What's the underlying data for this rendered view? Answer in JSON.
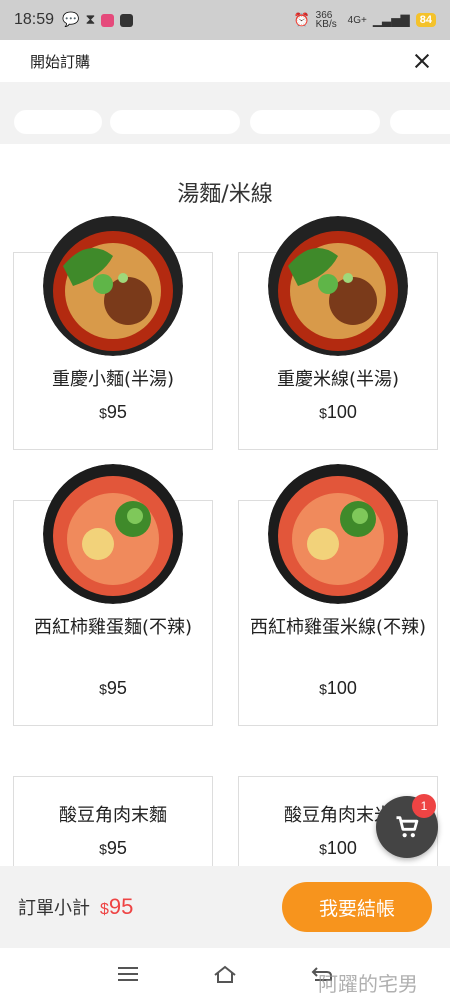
{
  "status_bar": {
    "time": "18:59",
    "battery": "84",
    "network": "4G+",
    "speed": "366 KB/s"
  },
  "header": {
    "title": "開始訂購"
  },
  "section": {
    "title": "湯麵/米線"
  },
  "items": [
    {
      "name": "重慶小麵(半湯)",
      "currency": "$",
      "price": "95"
    },
    {
      "name": "重慶米線(半湯)",
      "currency": "$",
      "price": "100"
    },
    {
      "name": "西紅柿雞蛋麵(不辣)",
      "currency": "$",
      "price": "95"
    },
    {
      "name": "西紅柿雞蛋米線(不辣)",
      "currency": "$",
      "price": "100"
    },
    {
      "name": "酸豆角肉末麵",
      "currency": "$",
      "price": "95"
    },
    {
      "name": "酸豆角肉末米",
      "currency": "$",
      "price": "100"
    }
  ],
  "cart": {
    "count": "1"
  },
  "footer": {
    "subtotal_label": "訂單小計",
    "currency": "$",
    "subtotal_value": "95",
    "checkout_label": "我要結帳"
  },
  "watermark": "阿躍的宅男",
  "colors": {
    "accent": "#f7941d",
    "price_red": "#e44444",
    "fab": "#444444"
  }
}
